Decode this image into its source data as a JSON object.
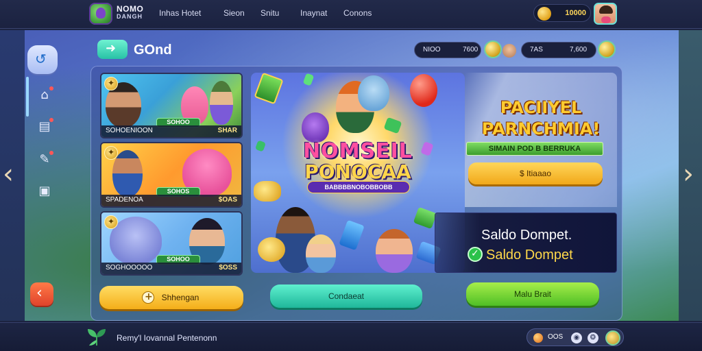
{
  "app": {
    "logo_line1": "NOMO",
    "logo_line2": "DANGH"
  },
  "topnav": {
    "items": [
      "Inhas Hotet",
      "Sieon",
      "Snitu",
      "Inaynat",
      "Conons"
    ]
  },
  "header": {
    "coin_balance": "10000"
  },
  "section": {
    "title": "GOnd"
  },
  "stats": [
    {
      "label": "NIOO",
      "value": "7600"
    },
    {
      "label": "7AS",
      "value": "7,600"
    }
  ],
  "games": [
    {
      "name_label": "SOHOENIOON",
      "tag": "SOHOO",
      "price": "SHAR"
    },
    {
      "name_label": "SPADENOA",
      "tag": "SOHOS",
      "price": "$OAS"
    },
    {
      "name_label": "SOGHOOOOO",
      "tag": "SOHOO",
      "price": "$OSS"
    }
  ],
  "hero": {
    "title_line1": "NOMSEIL",
    "title_line2": "PONOCAA",
    "subtitle": "BABBBBNOBOBBOBB"
  },
  "promo": {
    "title_line1": "PACIIYEL",
    "title_line2": "PARNCHMIA!",
    "tag": "SIMAIN POD B BERRUKA",
    "button_label": "$ Itiaaao"
  },
  "wallet": {
    "line1": "Saldo Dompet.",
    "line2": "Saldo Dompet"
  },
  "actions": {
    "shopping": "Shhengan",
    "continue": "Condaeat",
    "more": "Malu Brait"
  },
  "footer": {
    "text": "Remy'l Iovannal Pentenonn",
    "balance": "OOS"
  },
  "colors": {
    "accent_yellow": "#f4ae19",
    "accent_teal": "#1fb79a",
    "accent_green": "#4fbf26",
    "topbar": "#1b2240"
  }
}
